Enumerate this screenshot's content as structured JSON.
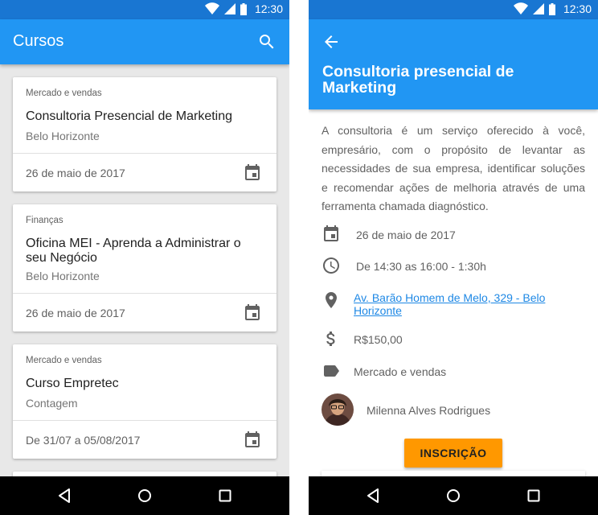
{
  "status_bar": {
    "time": "12:30"
  },
  "list_screen": {
    "app_title": "Cursos",
    "icons": {
      "search": "search-icon",
      "calendar": "calendar-icon"
    },
    "courses": [
      {
        "category": "Mercado e vendas",
        "title": "Consultoria Presencial de Marketing",
        "city": "Belo Horizonte",
        "date": "26 de maio de 2017"
      },
      {
        "category": "Finanças",
        "title": "Oficina MEI - Aprenda a Administrar o seu Negócio",
        "city": "Belo Horizonte",
        "date": "26 de maio de 2017"
      },
      {
        "category": "Mercado e vendas",
        "title": "Curso Empretec",
        "city": "Contagem",
        "date": "De 31/07 a 05/08/2017"
      }
    ]
  },
  "detail_screen": {
    "title": "Consultoria presencial de Marketing",
    "description": "A consultoria é um serviço oferecido à você, empresário, com o propósito de levantar as necessidades de sua empresa, identificar soluções e recomendar ações de melhoria através de uma ferramenta chamada diagnóstico.",
    "date": "26 de maio de 2017",
    "time": "De 14:30 as 16:00 - 1:30h",
    "address": "Av. Barão Homem de Melo, 329 - Belo Horizonte",
    "price": "R$150,00",
    "category": "Mercado e vendas",
    "instructor": "Milenna Alves Rodrigues",
    "button_label": "INSCRIÇÃO"
  },
  "colors": {
    "primary": "#2196f3",
    "primary_dark": "#1976d2",
    "accent": "#ff9800",
    "link": "#1e88e5",
    "navbar": "#000000"
  }
}
